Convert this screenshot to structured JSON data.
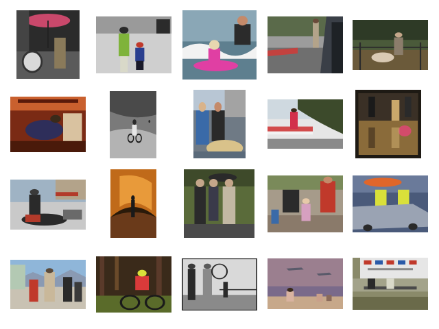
{
  "gallery": {
    "thumbnails": [
      {
        "subject": "person-with-red-umbrella-and-drum",
        "palette": [
          "#2b2b2b",
          "#c9486b",
          "#d9d9d9"
        ]
      },
      {
        "subject": "adult-and-child-on-snow",
        "palette": [
          "#cfcfcf",
          "#7fb33a",
          "#2a3f8f"
        ]
      },
      {
        "subject": "dog-surfing-pink-board",
        "palette": [
          "#8aa7b6",
          "#e03fa3",
          "#f2f2f2"
        ]
      },
      {
        "subject": "street-through-car-window",
        "palette": [
          "#3a3f47",
          "#9c9c9c",
          "#c3423f"
        ]
      },
      {
        "subject": "person-with-animal-in-pen",
        "palette": [
          "#4a5a3a",
          "#8b7d6b",
          "#2b2b2b"
        ]
      },
      {
        "subject": "person-in-cluttered-room",
        "palette": [
          "#7a2a14",
          "#c9602e",
          "#2e2e5a"
        ]
      },
      {
        "subject": "motocross-rider-black-and-white",
        "palette": [
          "#7a7a7a",
          "#b3b3b3",
          "#2a2a2a"
        ]
      },
      {
        "subject": "people-with-pastry-tray",
        "palette": [
          "#6f7a85",
          "#d9c28a",
          "#2a2a2a"
        ]
      },
      {
        "subject": "tree-over-red-barrier-street",
        "palette": [
          "#3c4a2b",
          "#d24b4b",
          "#e6e6e6"
        ]
      },
      {
        "subject": "reflection-on-wet-floor",
        "palette": [
          "#1e1a14",
          "#8a6b3a",
          "#c9a86b"
        ]
      },
      {
        "subject": "motorcycle-rider-on-street",
        "palette": [
          "#9fb3c4",
          "#2a2a2a",
          "#b23a2a"
        ]
      },
      {
        "subject": "person-in-orange-tunnel",
        "palette": [
          "#c06a1a",
          "#e89a3a",
          "#2a1a0a"
        ]
      },
      {
        "subject": "people-with-umbrellas-by-rocks",
        "palette": [
          "#5a6b3a",
          "#c2b8a3",
          "#2b2b2b"
        ]
      },
      {
        "subject": "adults-and-children-indoors",
        "palette": [
          "#a69b8a",
          "#c0392b",
          "#2b2b2b"
        ]
      },
      {
        "subject": "workers-with-orange-umbrella-and-car",
        "palette": [
          "#4a5a7a",
          "#e0662a",
          "#d9e03a"
        ]
      },
      {
        "subject": "pedestrians-with-mountains",
        "palette": [
          "#8fb6d9",
          "#5a4a3a",
          "#c0392b"
        ]
      },
      {
        "subject": "cyclist-in-forest",
        "palette": [
          "#3a2a1a",
          "#d93a3a",
          "#5a6b2a"
        ]
      },
      {
        "subject": "people-on-pier-black-and-white",
        "palette": [
          "#d9d9d9",
          "#2a2a2a",
          "#8a8a8a"
        ]
      },
      {
        "subject": "people-on-beach-with-planes",
        "palette": [
          "#9b7f8f",
          "#c7a88a",
          "#5a5a6a"
        ]
      },
      {
        "subject": "people-on-bench-under-banner",
        "palette": [
          "#e6e6e6",
          "#4a4a4a",
          "#8a8a6a"
        ]
      }
    ]
  }
}
